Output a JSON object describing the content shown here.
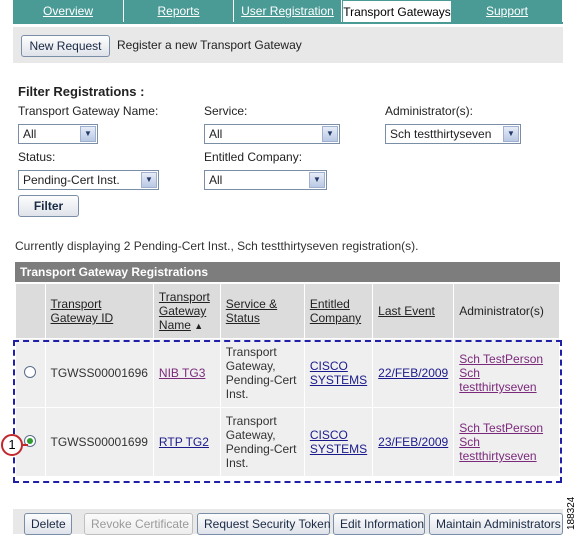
{
  "tabs": [
    "Overview",
    "Reports",
    "User Registration",
    "Transport Gateways",
    "Support"
  ],
  "toolbar": {
    "new_request": "New Request",
    "hint": "Register a new Transport Gateway"
  },
  "filter": {
    "heading": "Filter Registrations :",
    "tg_name_label": "Transport Gateway Name:",
    "tg_name_value": "All",
    "service_label": "Service:",
    "service_value": "All",
    "admin_label": "Administrator(s):",
    "admin_value": "Sch testthirtyseven",
    "status_label": "Status:",
    "status_value": "Pending-Cert Inst.",
    "company_label": "Entitled Company:",
    "company_value": "All",
    "filter_button": "Filter"
  },
  "display_text": "Currently displaying 2 Pending-Cert Inst., Sch testthirtyseven registration(s).",
  "table": {
    "title": "Transport Gateway Registrations",
    "headers": {
      "id": "Transport Gateway ID",
      "name": "Transport Gateway Name",
      "sort_arrow": "▲",
      "service": "Service & Status",
      "company": "Entitled Company",
      "last_event": "Last Event",
      "admins": "Administrator(s)"
    },
    "rows": [
      {
        "id": "TGWSS00001696",
        "name": "NIB TG3",
        "service": "Transport Gateway, Pending-Cert Inst.",
        "company": "CISCO SYSTEMS",
        "last_event": "22/FEB/2009",
        "admin1": "Sch TestPerson",
        "admin2": "Sch testthirtyseven",
        "selected": false
      },
      {
        "id": "TGWSS00001699",
        "name": "RTP TG2",
        "service": "Transport Gateway, Pending-Cert Inst.",
        "company": "CISCO SYSTEMS",
        "last_event": "23/FEB/2009",
        "admin1": "Sch TestPerson",
        "admin2": "Sch testthirtyseven",
        "selected": true
      }
    ]
  },
  "callout_number": "1",
  "bottom_buttons": {
    "delete": "Delete",
    "revoke": "Revoke Certificate",
    "request_token": "Request Security Token",
    "edit": "Edit Information",
    "maintain": "Maintain Administrators"
  },
  "figure_id": "188324"
}
